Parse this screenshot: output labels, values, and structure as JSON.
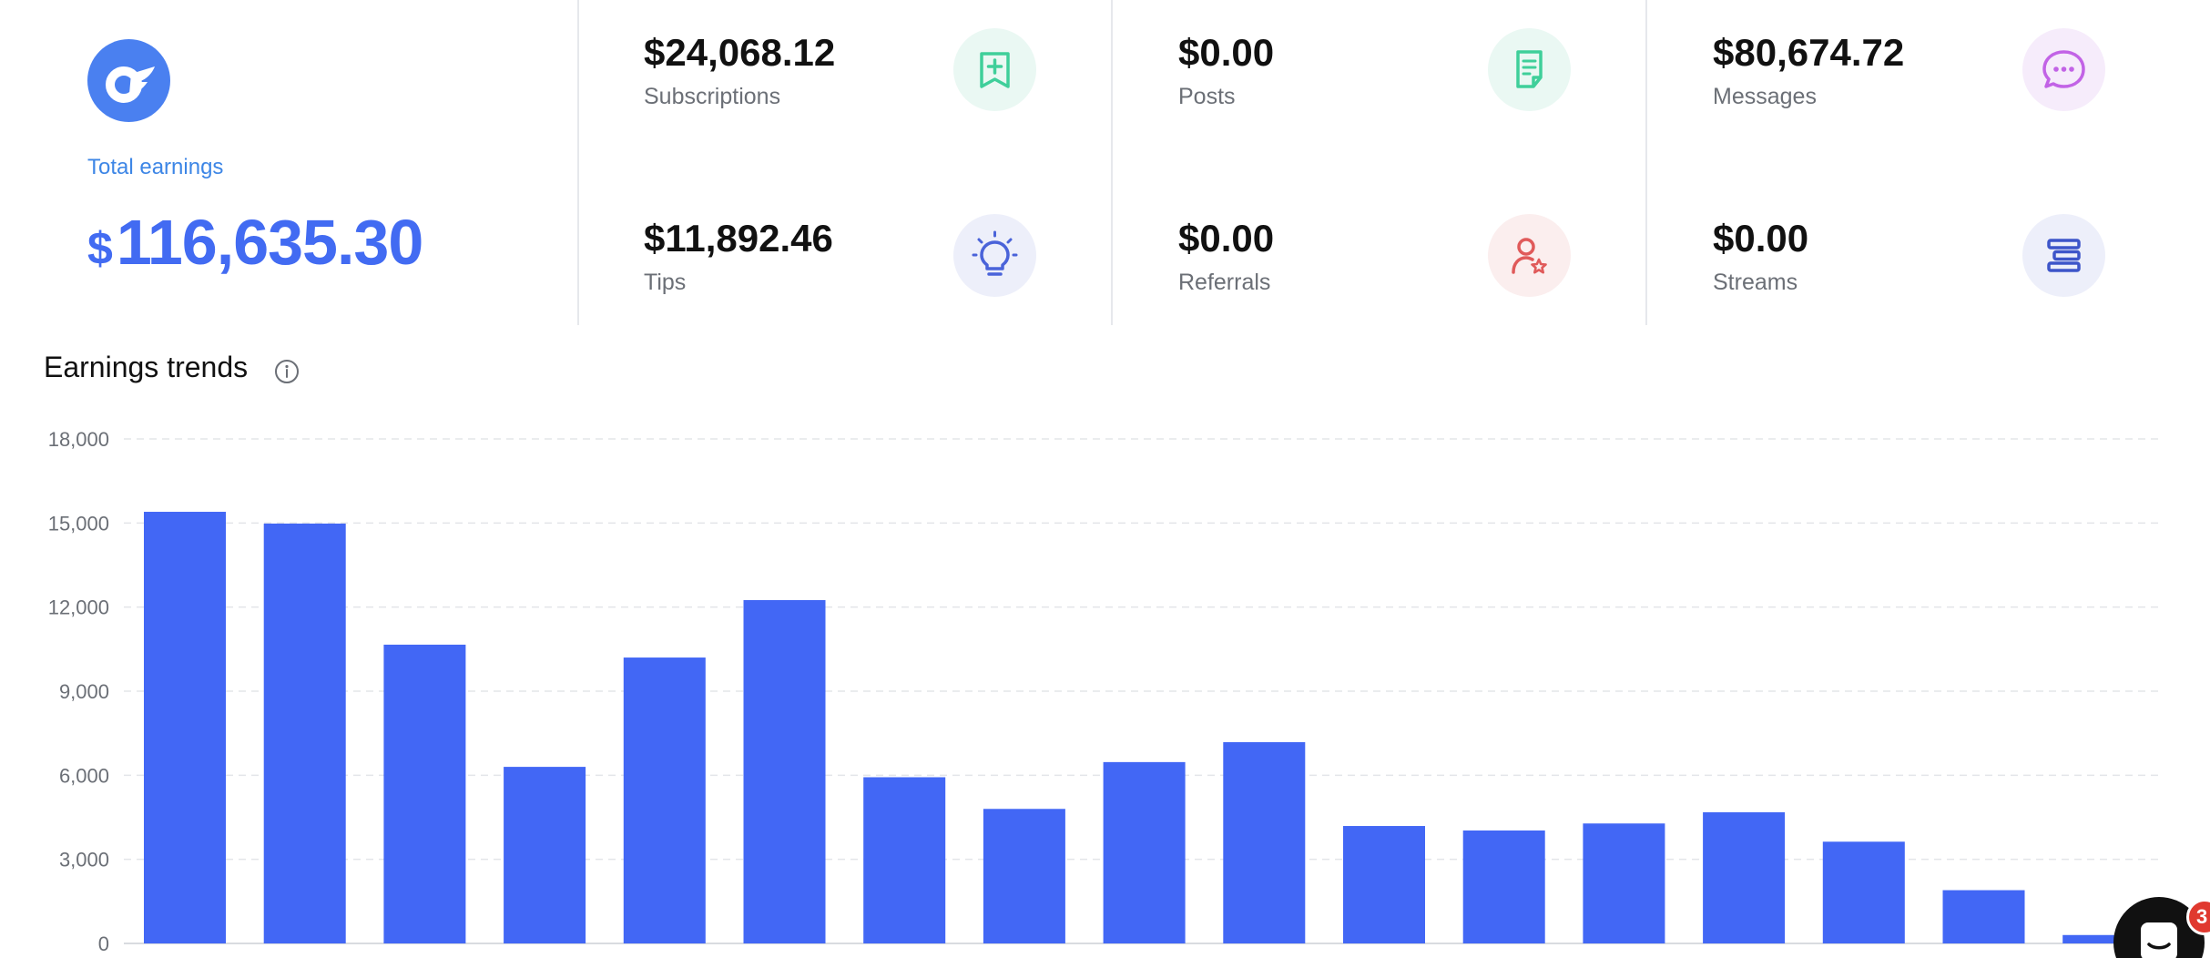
{
  "summary": {
    "total_label": "Total earnings",
    "total_currency": "$",
    "total_amount": "116,635.30"
  },
  "cards": [
    {
      "amount": "$24,068.12",
      "label": "Subscriptions",
      "icon": "bookmark-plus-icon",
      "color": "#3fcf9a",
      "bg": "#eaf8f3"
    },
    {
      "amount": "$0.00",
      "label": "Posts",
      "icon": "document-icon",
      "color": "#3fcf9a",
      "bg": "#eaf8f3"
    },
    {
      "amount": "$80,674.72",
      "label": "Messages",
      "icon": "chat-bubble-icon",
      "color": "#c263e6",
      "bg": "#f6ecfb"
    },
    {
      "amount": "$11,892.46",
      "label": "Tips",
      "icon": "lightbulb-icon",
      "color": "#4a63d9",
      "bg": "#edeffa"
    },
    {
      "amount": "$0.00",
      "label": "Referrals",
      "icon": "user-star-icon",
      "color": "#e05a5a",
      "bg": "#fbeeee"
    },
    {
      "amount": "$0.00",
      "label": "Streams",
      "icon": "streams-icon",
      "color": "#3d55c9",
      "bg": "#edeffa"
    }
  ],
  "trends": {
    "title": "Earnings trends",
    "info_icon": "info-icon"
  },
  "chat": {
    "badge_count": "3",
    "icon": "chat-launcher-icon"
  },
  "chart_data": {
    "type": "bar",
    "title": "Earnings trends",
    "xlabel": "",
    "ylabel": "",
    "ylim": [
      0,
      18000
    ],
    "yticks": [
      0,
      3000,
      6000,
      9000,
      12000,
      15000,
      18000
    ],
    "ytick_labels": [
      "0",
      "3,000",
      "6,000",
      "9,000",
      "12,000",
      "15,000",
      "18,000"
    ],
    "grid": true,
    "bar_color": "#4267f5",
    "values": [
      15400,
      14980,
      10660,
      6300,
      10200,
      12250,
      5930,
      4800,
      6470,
      7180,
      4190,
      4030,
      4280,
      4680,
      3630,
      1900,
      300
    ]
  }
}
